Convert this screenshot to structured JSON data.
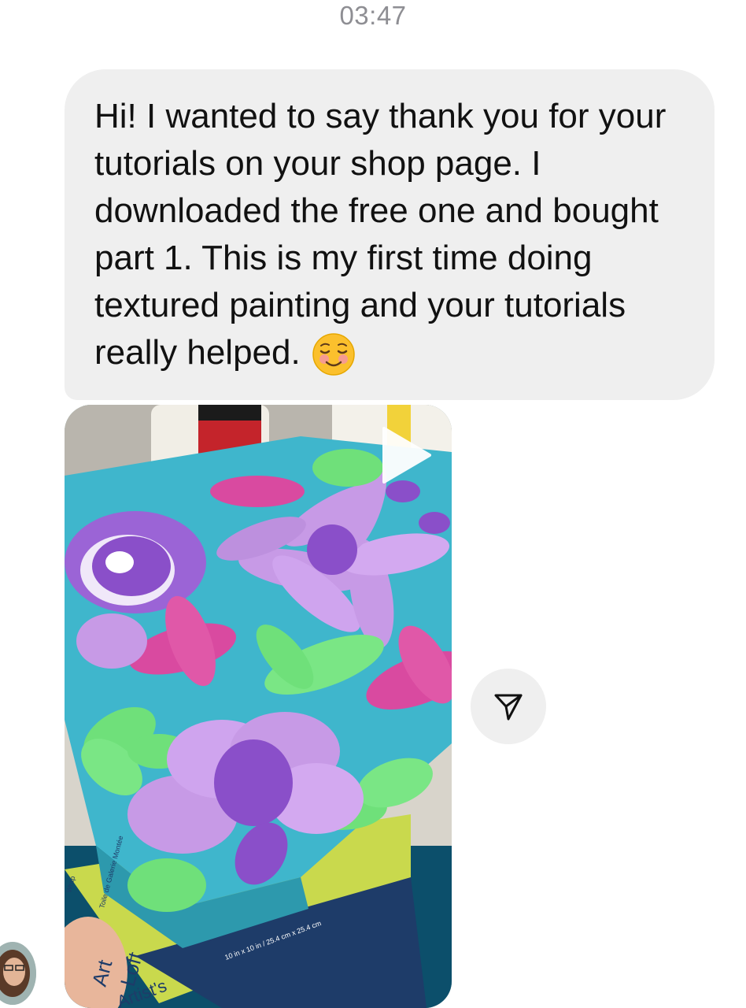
{
  "status": {
    "timestamp": "03:47"
  },
  "message": {
    "text": "Hi! I wanted to say thank you for your tutorials on your shop page. I downloaded the free one and bought part 1. This is my first time doing textured painting and your tutorials really helped.",
    "emoji": "smiling-face-emoji"
  },
  "video": {
    "play_icon": "play-icon",
    "canvas_brand_1": "Art",
    "canvas_brand_2": "Loft",
    "canvas_brand_3": "Artist's",
    "canvas_size": "10 in x 10 in / 25.4 cm x 25.4 cm",
    "canvas_label": "Toile de Galerie Montée",
    "canvas_wrap": "Wrap"
  },
  "actions": {
    "share_icon": "paper-plane-icon"
  },
  "colors": {
    "bubble": "#efefef",
    "timestamp": "#8e8e93",
    "canvas_blue": "#3fb6cc",
    "lavender": "#c79ae6",
    "purple": "#8a4fc9",
    "magenta": "#d94aa0",
    "green": "#6fe07a"
  }
}
